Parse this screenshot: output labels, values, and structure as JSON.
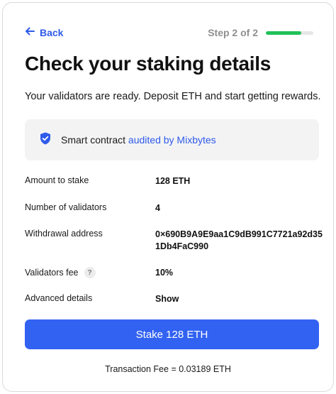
{
  "header": {
    "back_label": "Back",
    "step_label": "Step 2 of 2",
    "progress_fraction": 0.75,
    "progress_color": "#21c157"
  },
  "title": "Check your staking details",
  "subtitle": "Your validators are ready. Deposit ETH and start getting rewards.",
  "audit": {
    "icon": "shield-check-icon",
    "prefix": "Smart contract",
    "link_text": "audited by Mixbytes"
  },
  "details": {
    "amount_label": "Amount to stake",
    "amount_value": "128 ETH",
    "validators_label": "Number of validators",
    "validators_value": "4",
    "withdrawal_label": "Withdrawal address",
    "withdrawal_value": "0×690B9A9E9aa1C9dB991C7721a92d351Db4FaC990",
    "fee_label": "Validators fee",
    "fee_help": "?",
    "fee_value": "10%",
    "advanced_label": "Advanced details",
    "advanced_link": "Show"
  },
  "stake_button_label": "Stake 128 ETH",
  "transaction_fee": "Transaction Fee = 0.03189 ETH",
  "colors": {
    "accent": "#2f5bea",
    "button": "#3262f2"
  }
}
